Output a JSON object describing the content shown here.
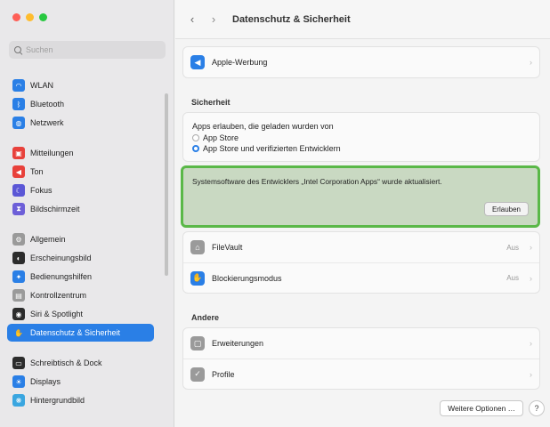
{
  "window": {
    "title": "Datenschutz & Sicherheit"
  },
  "toolbar": {
    "back_glyph": "‹",
    "forward_glyph": "›"
  },
  "search": {
    "placeholder": "Suchen"
  },
  "sidebar": {
    "items": [
      {
        "label": "WLAN",
        "icon": "wifi-icon",
        "color": "#2a7fe6",
        "glyph": "◠"
      },
      {
        "label": "Bluetooth",
        "icon": "bluetooth-icon",
        "color": "#2a7fe6",
        "glyph": "ᛒ"
      },
      {
        "label": "Netzwerk",
        "icon": "globe-icon",
        "color": "#2a7fe6",
        "glyph": "◍"
      },
      {
        "label": "Mitteilungen",
        "icon": "bell-icon",
        "color": "#e8413b",
        "glyph": "▣"
      },
      {
        "label": "Ton",
        "icon": "speaker-icon",
        "color": "#e8413b",
        "glyph": "◀"
      },
      {
        "label": "Fokus",
        "icon": "moon-icon",
        "color": "#5b57d6",
        "glyph": "☾"
      },
      {
        "label": "Bildschirmzeit",
        "icon": "hourglass-icon",
        "color": "#6d5fd8",
        "glyph": "⧗"
      },
      {
        "label": "Allgemein",
        "icon": "gear-icon",
        "color": "#9a9a9a",
        "glyph": "⚙"
      },
      {
        "label": "Erscheinungsbild",
        "icon": "appearance-icon",
        "color": "#2c2c2c",
        "glyph": "◐"
      },
      {
        "label": "Bedienungshilfen",
        "icon": "accessibility-icon",
        "color": "#2a7fe6",
        "glyph": "✦"
      },
      {
        "label": "Kontrollzentrum",
        "icon": "control-center-icon",
        "color": "#9a9a9a",
        "glyph": "▤"
      },
      {
        "label": "Siri & Spotlight",
        "icon": "siri-icon",
        "color": "#2c2c2c",
        "glyph": "◉"
      },
      {
        "label": "Datenschutz & Sicherheit",
        "icon": "hand-icon",
        "color": "#2a7fe6",
        "glyph": "✋"
      },
      {
        "label": "Schreibtisch & Dock",
        "icon": "dock-icon",
        "color": "#2c2c2c",
        "glyph": "▭"
      },
      {
        "label": "Displays",
        "icon": "display-icon",
        "color": "#2a7fe6",
        "glyph": "☀"
      },
      {
        "label": "Hintergrundbild",
        "icon": "wallpaper-icon",
        "color": "#3aa6e0",
        "glyph": "❋"
      }
    ],
    "active_index": 12
  },
  "main": {
    "apple_ads": {
      "label": "Apple-Werbung",
      "icon": "megaphone-icon",
      "color": "#2a7fe6",
      "glyph": "◀"
    },
    "security": {
      "title": "Sicherheit",
      "allow_text": "Apps erlauben, die geladen wurden von",
      "options": [
        {
          "label": "App Store",
          "checked": false
        },
        {
          "label": "App Store und verifizierten Entwicklern",
          "checked": true
        }
      ]
    },
    "notice": {
      "text": "Systemsoftware des Entwicklers „Intel Corporation Apps“ wurde aktualisiert.",
      "button": "Erlauben"
    },
    "filevault": {
      "label": "FileVault",
      "value": "Aus",
      "icon": "filevault-icon",
      "color": "#9a9a9a",
      "glyph": "⌂"
    },
    "lockdown": {
      "label": "Blockierungsmodus",
      "value": "Aus",
      "icon": "lockdown-hand-icon",
      "color": "#2a7fe6",
      "glyph": "✋"
    },
    "other": {
      "title": "Andere",
      "extensions": {
        "label": "Erweiterungen",
        "icon": "extensions-icon",
        "color": "#9a9a9a",
        "glyph": "▢"
      },
      "profiles": {
        "label": "Profile",
        "icon": "profiles-icon",
        "color": "#9a9a9a",
        "glyph": "✓"
      }
    },
    "more_button": "Weitere Optionen …",
    "help_button": "?",
    "chevron": "›"
  }
}
